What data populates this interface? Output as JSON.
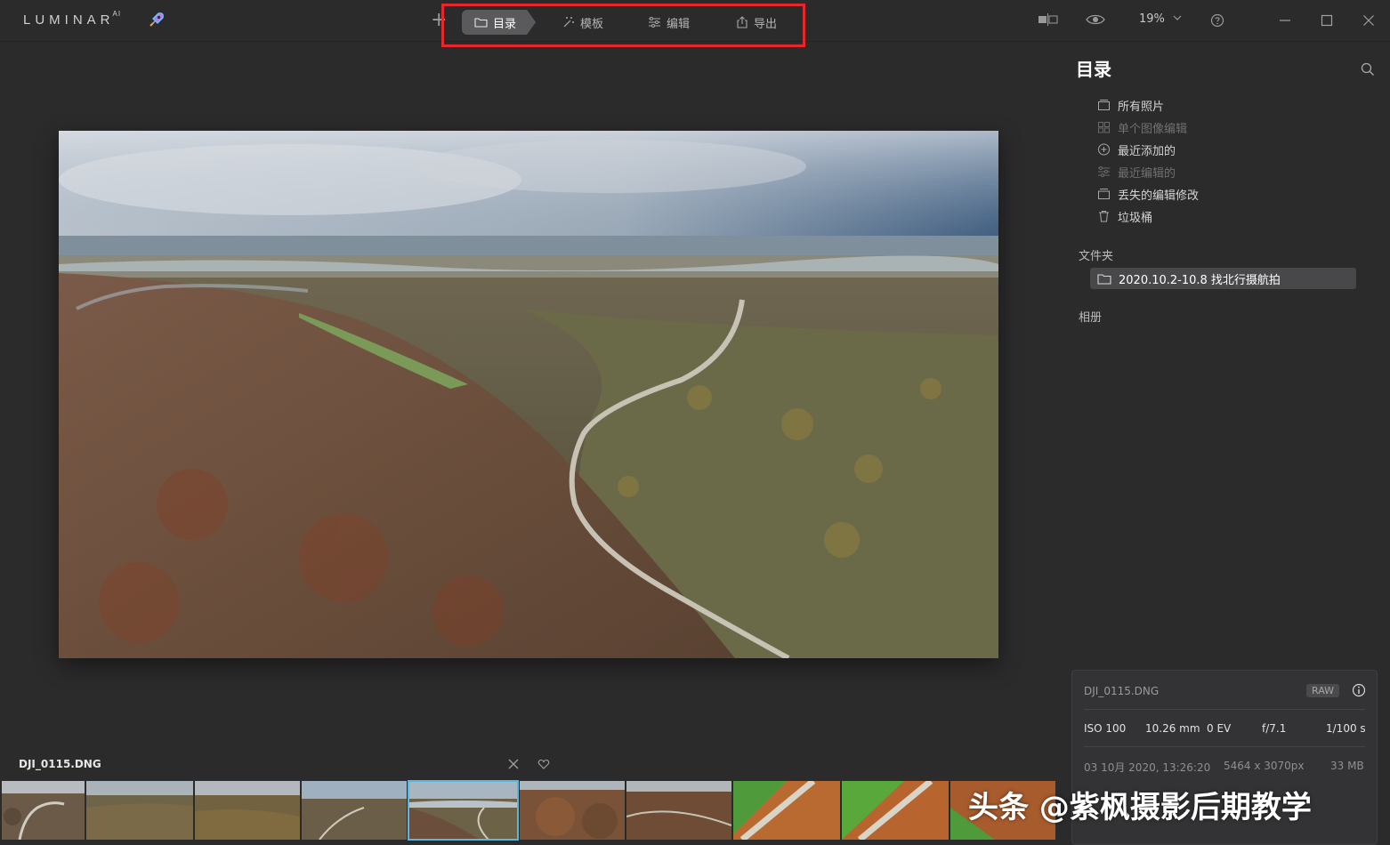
{
  "app": {
    "logo": "LUMINAR",
    "logo_suffix": "AI"
  },
  "tabs": [
    {
      "label": "目录",
      "icon": "folder-icon",
      "active": true
    },
    {
      "label": "模板",
      "icon": "magic-wand-icon",
      "active": false
    },
    {
      "label": "编辑",
      "icon": "sliders-icon",
      "active": false
    },
    {
      "label": "导出",
      "icon": "share-icon",
      "active": false
    }
  ],
  "toolbar": {
    "zoom": "19%"
  },
  "catalog": {
    "title": "目录",
    "items": [
      {
        "label": "所有照片",
        "icon": "photos-icon",
        "enabled": true
      },
      {
        "label": "单个图像编辑",
        "icon": "grid-icon",
        "enabled": false
      },
      {
        "label": "最近添加的",
        "icon": "plus-circle-icon",
        "enabled": true
      },
      {
        "label": "最近编辑的",
        "icon": "sliders-icon",
        "enabled": false
      },
      {
        "label": "丢失的编辑修改",
        "icon": "stack-icon",
        "enabled": true
      },
      {
        "label": "垃圾桶",
        "icon": "trash-icon",
        "enabled": true
      }
    ],
    "folders_label": "文件夹",
    "folder": "2020.10.2-10.8 找北行摄航拍",
    "albums_label": "相册"
  },
  "info": {
    "filename": "DJI_0115.DNG",
    "badge": "RAW",
    "iso": "ISO 100",
    "focal": "10.26 mm",
    "ev": "0 EV",
    "aperture": "f/7.1",
    "shutter": "1/100 s",
    "date": "03 10月 2020, 13:26:20",
    "dimensions": "5464 x 3070px",
    "size": "33 MB"
  },
  "filmstrip": {
    "current": "DJI_0115.DNG",
    "selected_index": 4,
    "thumb_count": 10
  },
  "watermark": "头条 @紫枫摄影后期教学",
  "colors": {
    "accent": "#59b8e0",
    "highlight": "#e8262b",
    "background": "#2b2b2c"
  }
}
